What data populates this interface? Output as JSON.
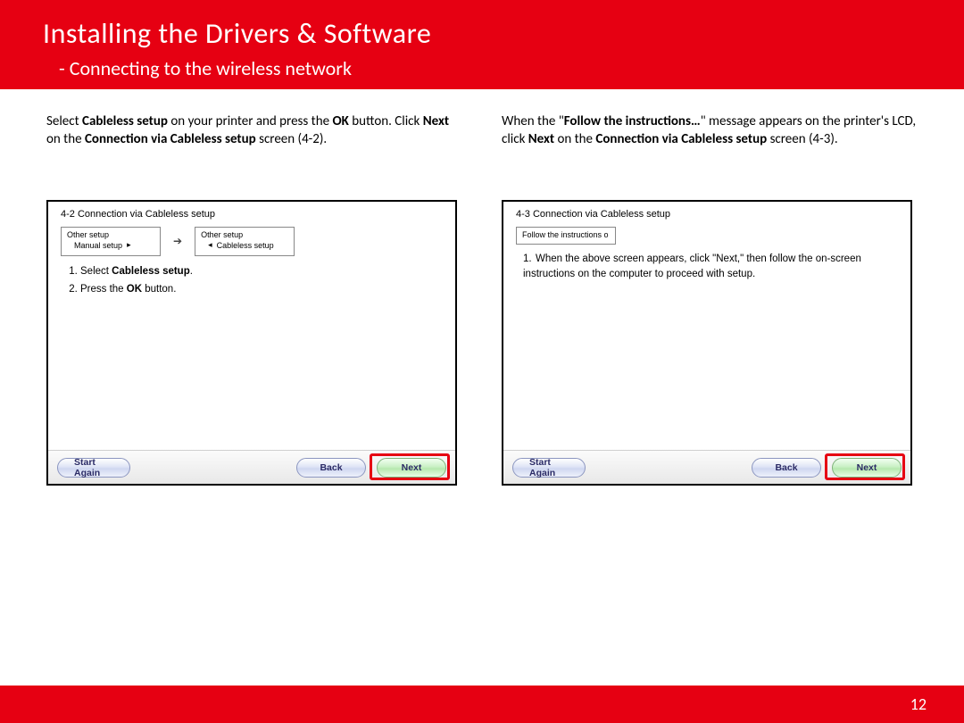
{
  "header": {
    "title": "Installing  the Drivers & Software",
    "subtitle": "- Connecting  to the wireless network"
  },
  "left": {
    "instr_parts": {
      "p1": "Select ",
      "b1": "Cableless setup",
      "p2": " on your printer and press the ",
      "b2": "OK",
      "p3": " button.  Click  ",
      "b3": "Next",
      "p4": " on the ",
      "b4": "Connection via Cableless setup",
      "p5": " screen (4-2)."
    },
    "dialog": {
      "title": "4-2 Connection via Cableless setup",
      "lcd1_l1": "Other setup",
      "lcd1_l2": "Manual setup",
      "lcd1_sym": "▸",
      "lcd2_l1": "Other setup",
      "lcd2_sym": "◂",
      "lcd2_l2": "Cableless setup",
      "step1_a": "Select ",
      "step1_b": "Cableless setup",
      "step1_c": ".",
      "step2_a": "Press the ",
      "step2_b": "OK",
      "step2_c": " button.",
      "btn_start": "Start Again",
      "btn_back": "Back",
      "btn_next": "Next"
    }
  },
  "right": {
    "instr_parts": {
      "p1": "When the \"",
      "b1": "Follow the instructions…",
      "p2": "\" message appears on the printer's LCD,  click  ",
      "b2": "Next",
      "p3": " on the ",
      "b3": "Connection via Cableless setup",
      "p4": " screen (4-3)."
    },
    "dialog": {
      "title": "4-3 Connection via Cableless setup",
      "lcd_text": "Follow the instructions o",
      "step1": "When the above screen appears, click \"Next,\" then follow the on-screen instructions on the computer to proceed with setup.",
      "btn_start": "Start Again",
      "btn_back": "Back",
      "btn_next": "Next"
    }
  },
  "footer": {
    "page_number": "12"
  }
}
